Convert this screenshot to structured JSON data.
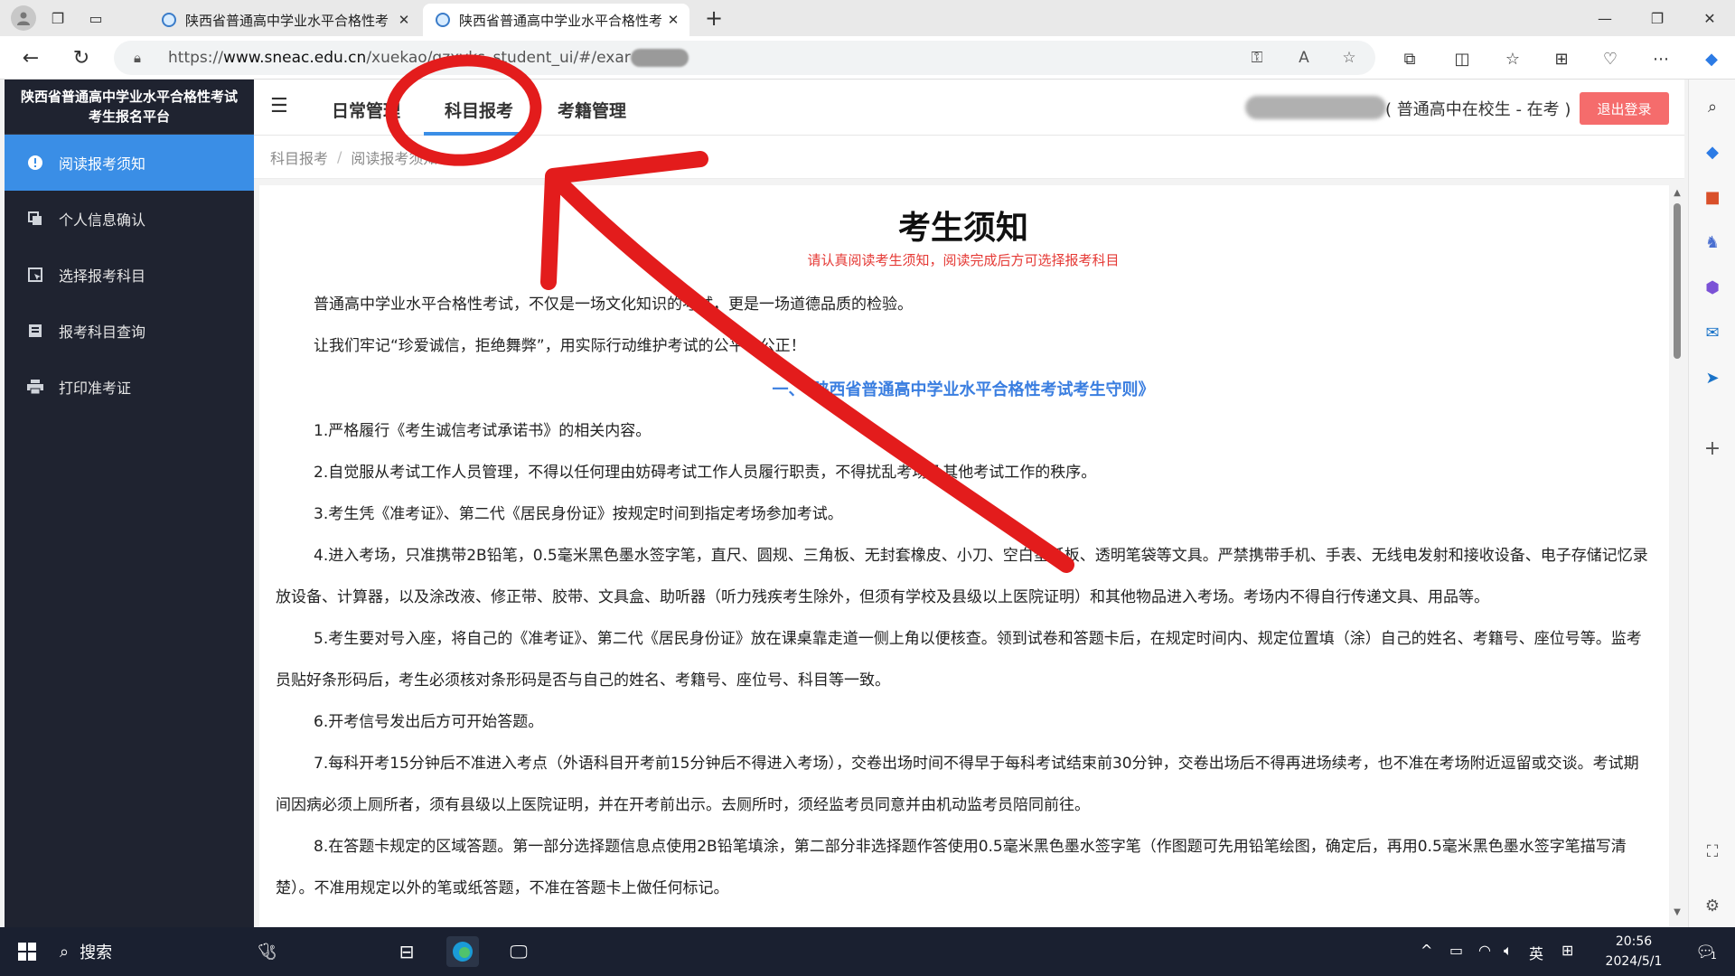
{
  "browser": {
    "tabs": [
      {
        "title": "陕西省普通高中学业水平合格性考"
      },
      {
        "title": "陕西省普通高中学业水平合格性考"
      }
    ],
    "new_tab": "+",
    "url_prefix": "https://",
    "url_domain": "www.sneac.edu.cn",
    "url_path": "/xuekao/gzxyks_student_ui/#/exar"
  },
  "sidebar": {
    "title_line1": "陕西省普通高中学业水平合格性考试",
    "title_line2": "考生报名平台",
    "items": [
      {
        "label": "阅读报考须知",
        "icon": "info-icon"
      },
      {
        "label": "个人信息确认",
        "icon": "copy-icon"
      },
      {
        "label": "选择报考科目",
        "icon": "select-icon"
      },
      {
        "label": "报考科目查询",
        "icon": "list-icon"
      },
      {
        "label": "打印准考证",
        "icon": "printer-icon"
      }
    ]
  },
  "header": {
    "tabs": [
      {
        "label": "日常管理"
      },
      {
        "label": "科目报考"
      },
      {
        "label": "考籍管理"
      }
    ],
    "user_role": "( 普通高中在校生 - 在考 )",
    "logout_label": "退出登录"
  },
  "breadcrumb": {
    "items": [
      "科目报考",
      "阅读报考须知"
    ],
    "separator": "/"
  },
  "notice": {
    "title": "考生须知",
    "subtitle": "请认真阅读考生须知，阅读完成后方可选择报考科目",
    "intro1": "普通高中学业水平合格性考试，不仅是一场文化知识的考试，更是一场道德品质的检验。",
    "intro2": "让我们牢记“珍爱诚信，拒绝舞弊”，用实际行动维护考试的公平、公正！",
    "section_title": "一、《陕西省普通高中学业水平合格性考试考生守则》",
    "rules": [
      "1.严格履行《考生诚信考试承诺书》的相关内容。",
      "2.自觉服从考试工作人员管理，不得以任何理由妨碍考试工作人员履行职责，不得扰乱考场及其他考试工作的秩序。",
      "3.考生凭《准考证》、第二代《居民身份证》按规定时间到指定考场参加考试。",
      "4.进入考场，只准携带2B铅笔，0.5毫米黑色墨水签字笔，直尺、圆规、三角板、无封套橡皮、小刀、空白垫纸板、透明笔袋等文具。严禁携带手机、手表、无线电发射和接收设备、电子存储记忆录放设备、计算器，以及涂改液、修正带、胶带、文具盒、助听器（听力残疾考生除外，但须有学校及县级以上医院证明）和其他物品进入考场。考场内不得自行传递文具、用品等。",
      "5.考生要对号入座，将自己的《准考证》、第二代《居民身份证》放在课桌靠走道一侧上角以便核查。领到试卷和答题卡后，在规定时间内、规定位置填（涂）自己的姓名、考籍号、座位号等。监考员贴好条形码后，考生必须核对条形码是否与自己的姓名、考籍号、座位号、科目等一致。",
      "6.开考信号发出后方可开始答题。",
      "7.每科开考15分钟后不准进入考点（外语科目开考前15分钟后不得进入考场），交卷出场时间不得早于每科考试结束前30分钟，交卷出场后不得再进场续考，也不准在考场附近逗留或交谈。考试期间因病必须上厕所者，须有县级以上医院证明，并在开考前出示。去厕所时，须经监考员同意并由机动监考员陪同前往。",
      "8.在答题卡规定的区域答题。第一部分选择题信息点使用2B铅笔填涂，第二部分非选择题作答使用0.5毫米黑色墨水签字笔（作图题可先用铅笔绘图，确定后，再用0.5毫米黑色墨水签字笔描写清楚）。不准用规定以外的笔或纸答题，不准在答题卡上做任何标记。"
    ]
  },
  "taskbar": {
    "search_label": "搜索",
    "ime_label": "英",
    "time": "20:56",
    "date": "2024/5/1",
    "notif_count": "1"
  },
  "colors": {
    "sidebar_bg": "#1f2330",
    "active_blue": "#3a8ee6",
    "logout_red": "#f56c6c",
    "section_blue": "#3a7ee0",
    "subtitle_red": "#e53935",
    "annotation_red": "#e31c1c"
  }
}
